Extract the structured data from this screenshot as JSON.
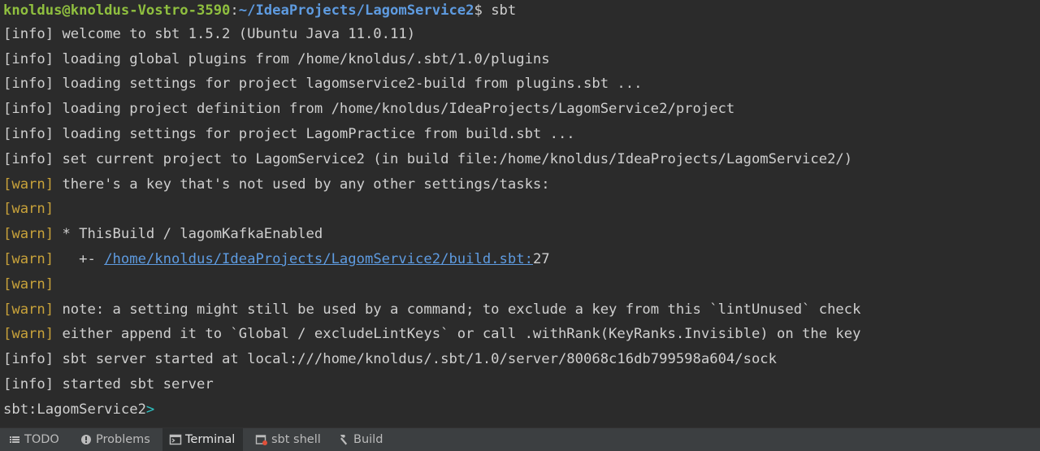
{
  "terminal": {
    "prompt": {
      "user_host": "knoldus@knoldus-Vostro-3590",
      "colon": ":",
      "path": "~/IdeaProjects/LagomService2",
      "symbol": "$ ",
      "command": "sbt"
    },
    "lines": [
      {
        "tag": "[info]",
        "text": " welcome to sbt 1.5.2 (Ubuntu Java 11.0.11)"
      },
      {
        "tag": "[info]",
        "text": " loading global plugins from /home/knoldus/.sbt/1.0/plugins"
      },
      {
        "tag": "[info]",
        "text": " loading settings for project lagomservice2-build from plugins.sbt ..."
      },
      {
        "tag": "[info]",
        "text": " loading project definition from /home/knoldus/IdeaProjects/LagomService2/project"
      },
      {
        "tag": "[info]",
        "text": " loading settings for project LagomPractice from build.sbt ..."
      },
      {
        "tag": "[info]",
        "text": " set current project to LagomService2 (in build file:/home/knoldus/IdeaProjects/LagomService2/)"
      },
      {
        "tag": "[warn]",
        "text": " there's a key that's not used by any other settings/tasks:"
      },
      {
        "tag": "[warn]",
        "text": ""
      },
      {
        "tag": "[warn]",
        "text": " * ThisBuild / lagomKafkaEnabled"
      },
      {
        "tag": "[warn]",
        "text": "   +- ",
        "link": "/home/knoldus/IdeaProjects/LagomService2/build.sbt:",
        "suffix": "27"
      },
      {
        "tag": "[warn]",
        "text": ""
      },
      {
        "tag": "[warn]",
        "text": " note: a setting might still be used by a command; to exclude a key from this `lintUnused` check"
      },
      {
        "tag": "[warn]",
        "text": " either append it to `Global / excludeLintKeys` or call .withRank(KeyRanks.Invisible) on the key"
      },
      {
        "tag": "[info]",
        "text": " sbt server started at local:///home/knoldus/.sbt/1.0/server/80068c16db799598a604/sock"
      },
      {
        "tag": "[info]",
        "text": " started sbt server"
      }
    ],
    "sbt_prompt": "sbt:LagomService2",
    "sbt_caret": ">"
  },
  "toolbar": {
    "tabs": [
      {
        "label": "TODO",
        "icon": "list-icon"
      },
      {
        "label": "Problems",
        "icon": "problems-icon"
      },
      {
        "label": "Terminal",
        "icon": "terminal-icon",
        "active": true
      },
      {
        "label": "sbt shell",
        "icon": "sbt-shell-icon"
      },
      {
        "label": "Build",
        "icon": "hammer-icon"
      }
    ]
  },
  "colors": {
    "background": "#2b2b2b",
    "user_host": "#8fbf3f",
    "path": "#5e9be0",
    "warn": "#c8a23a",
    "link": "#5e9be0",
    "caret": "#2ec4c4",
    "toolbar": "#3c3f41"
  }
}
